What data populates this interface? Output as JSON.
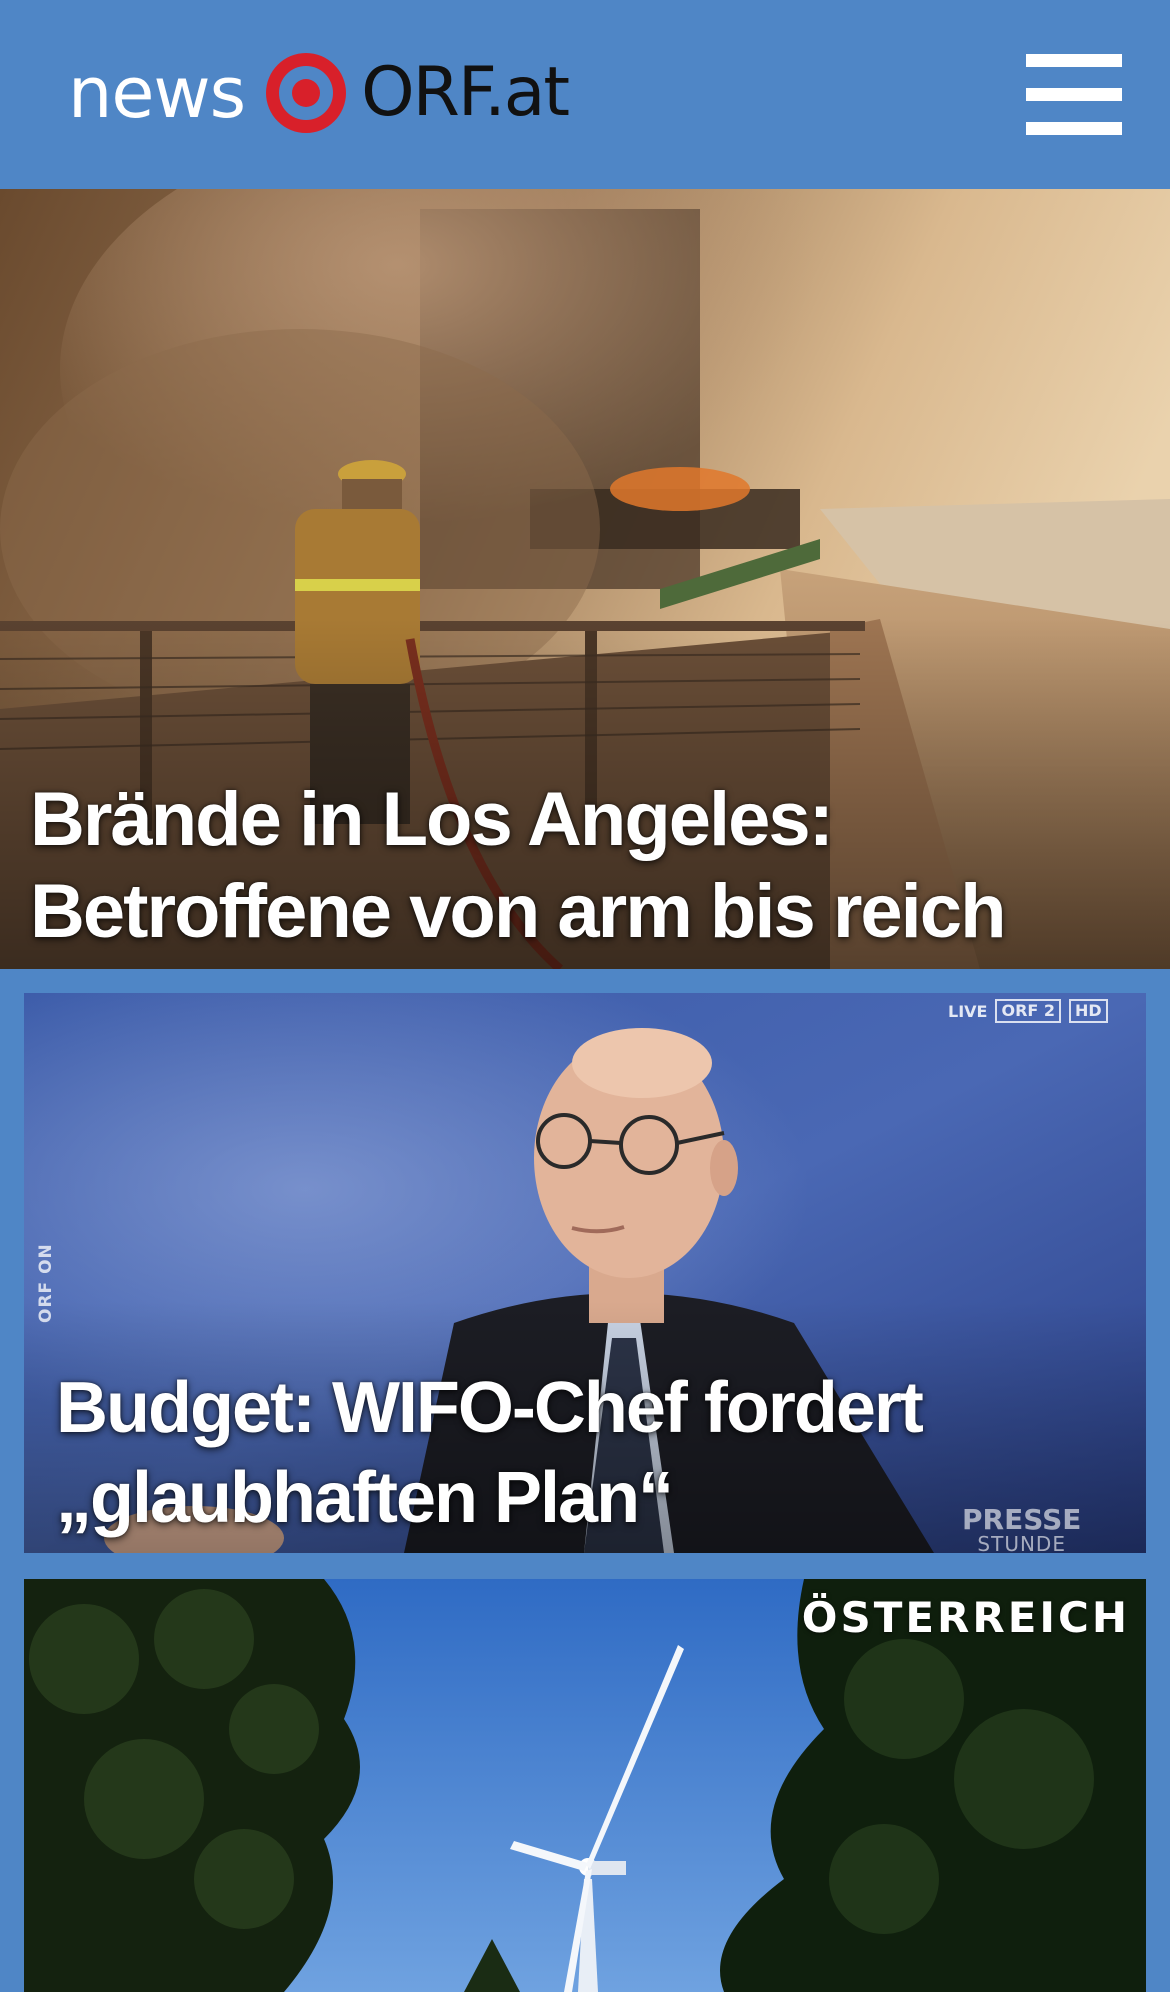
{
  "header": {
    "logo_news": "news",
    "logo_orf": "ORF.at",
    "logo_accent": "#d8202a",
    "menu_icon": "hamburger-menu-icon",
    "background": "#4f86c6"
  },
  "teasers": [
    {
      "headline": "Brände in Los Angeles: Betroffene von arm bis reich"
    },
    {
      "headline": "Budget: WIFO-Chef fordert „glaubhaften Plan“",
      "side_label": "ORF ON",
      "badge_live": "LIVE",
      "badge_channel": "ORF 2",
      "badge_hd": "HD",
      "watermark_top": "PRESSE",
      "watermark_bottom": "STUNDE"
    },
    {
      "category": "ÖSTERREICH"
    }
  ]
}
